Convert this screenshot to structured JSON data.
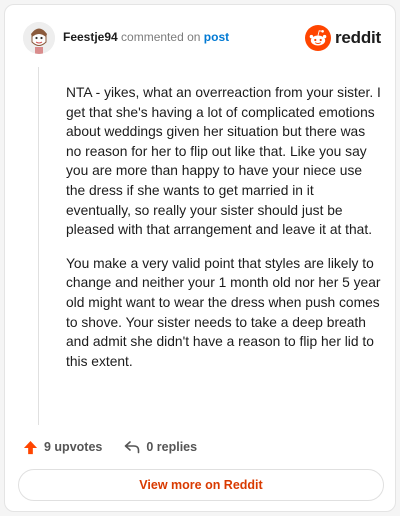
{
  "comment": {
    "username": "Feestje94",
    "commented_on": "commented on",
    "post_link": "post",
    "paragraphs": [
      "NTA - yikes, what an overreaction from your sister. I get that she's having a lot of complicated emotions about weddings given her situation but there was no reason for her to flip out like that. Like you say you are more than happy to have your niece use the dress if she wants to get married in it eventually, so really your sister should just be pleased with that arrangement and leave it at that.",
      "You make a very valid point that styles are likely to change and neither your 1 month old nor her 5 year old might want to wear the dress when push comes to shove. Your sister needs to take a deep breath and admit she didn't have a reason to flip her lid to this extent."
    ],
    "upvotes": "9 upvotes",
    "replies": "0 replies"
  },
  "brand": {
    "name": "reddit",
    "accent": "#ff4500"
  },
  "footer": {
    "view_more": "View more on Reddit"
  },
  "icons": {
    "upvote": "upvote-arrow-icon",
    "reply": "reply-arrow-icon",
    "logo": "reddit-alien-icon"
  }
}
